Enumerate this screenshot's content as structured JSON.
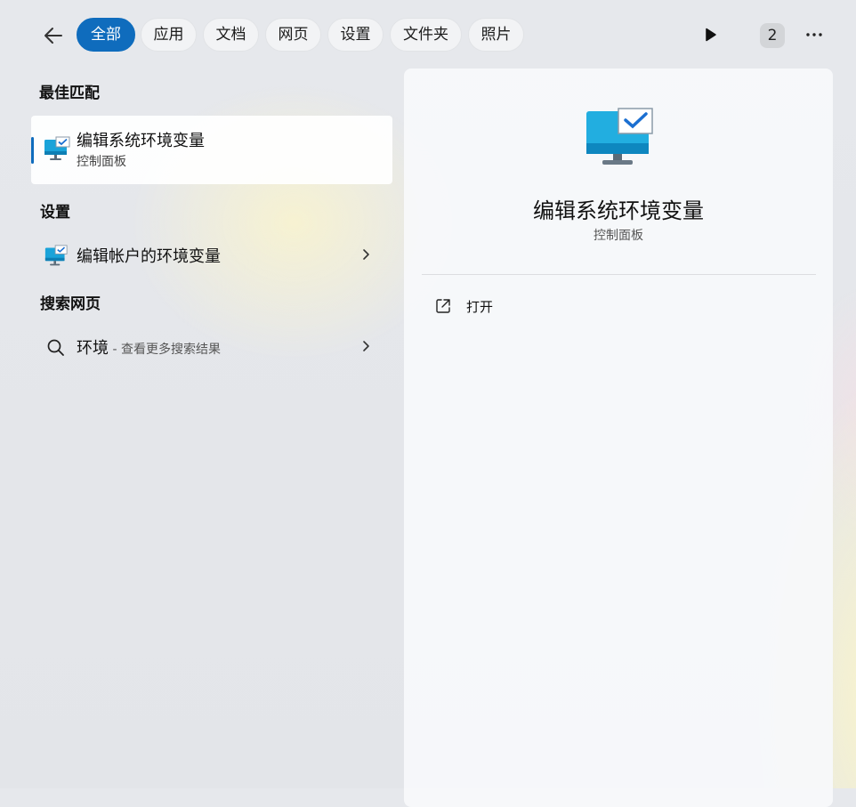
{
  "tabs": [
    {
      "label": "全部",
      "active": true
    },
    {
      "label": "应用",
      "active": false
    },
    {
      "label": "文档",
      "active": false
    },
    {
      "label": "网页",
      "active": false
    },
    {
      "label": "设置",
      "active": false
    },
    {
      "label": "文件夹",
      "active": false
    },
    {
      "label": "照片",
      "active": false
    }
  ],
  "toolbar": {
    "back_icon": "arrow-left-icon",
    "play_icon": "play-icon",
    "badge_count": "2",
    "more_icon": "more-icon"
  },
  "sections": {
    "best_match": "最佳匹配",
    "settings": "设置",
    "web_search": "搜索网页"
  },
  "best_match": {
    "title": "编辑系统环境变量",
    "subtitle": "控制面板",
    "icon": "system-monitor-icon"
  },
  "settings_item": {
    "title": "编辑帐户的环境变量",
    "icon": "system-monitor-icon"
  },
  "web_item": {
    "query": "环境",
    "suffix": " - 查看更多搜索结果",
    "icon": "search-icon"
  },
  "detail": {
    "title": "编辑系统环境变量",
    "subtitle": "控制面板",
    "actions": [
      {
        "label": "打开",
        "icon": "open-external-icon"
      }
    ]
  },
  "colors": {
    "accent": "#0f6cbd",
    "monitor": "#1aa3d9"
  }
}
